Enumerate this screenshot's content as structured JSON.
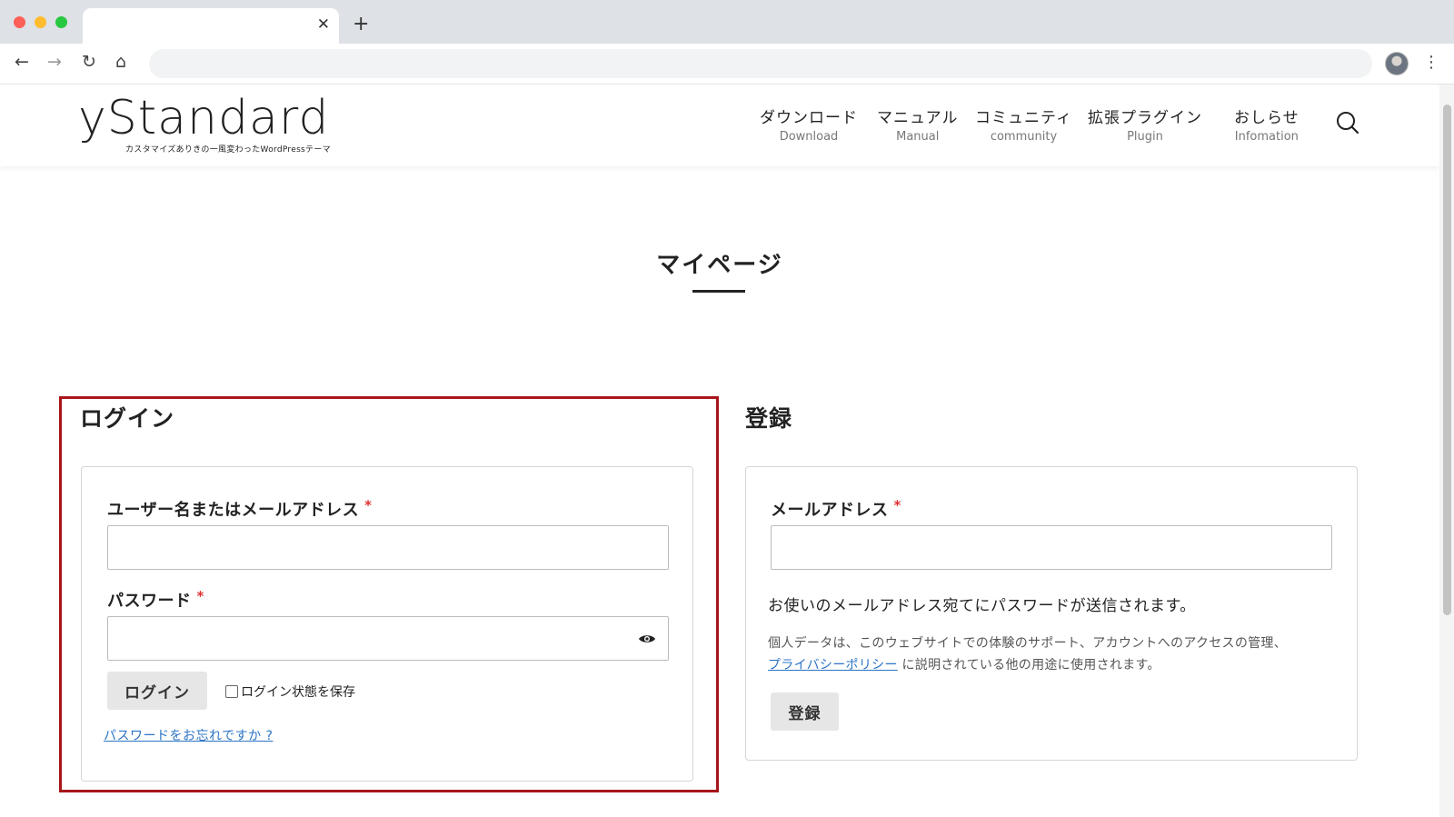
{
  "browser": {
    "tab_title": "",
    "tab_close": "✕",
    "new_tab": "+",
    "back": "←",
    "forward": "→",
    "reload": "↻",
    "home": "⌂",
    "menu": "⋮",
    "address": ""
  },
  "site": {
    "logo_text": "yStandard",
    "logo_tagline": "カスタマイズありきの一風変わったWordPressテーマ",
    "nav": [
      {
        "jp": "ダウンロード",
        "en": "Download"
      },
      {
        "jp": "マニュアル",
        "en": "Manual"
      },
      {
        "jp": "コミュニティ",
        "en": "community"
      },
      {
        "jp": "拡張プラグイン",
        "en": "Plugin"
      },
      {
        "jp": "おしらせ",
        "en": "Infomation"
      }
    ]
  },
  "page": {
    "title": "マイページ"
  },
  "login": {
    "heading": "ログイン",
    "username_label": "ユーザー名またはメールアドレス",
    "username_value": "",
    "password_label": "パスワード",
    "password_value": "",
    "required_mark": "*",
    "submit_label": "ログイン",
    "remember_label": "ログイン状態を保存",
    "remember_checked": false,
    "lost_password": "パスワードをお忘れですか ?"
  },
  "register": {
    "heading": "登録",
    "email_label": "メールアドレス",
    "email_value": "",
    "required_mark": "*",
    "notice": "お使いのメールアドレス宛てにパスワードが送信されます。",
    "privacy_text_1": "個人データは、このウェブサイトでの体験のサポート、アカウントへのアクセスの管理、",
    "privacy_link": "プライバシーポリシー",
    "privacy_text_2": " に説明されている他の用途に使用されます。",
    "submit_label": "登録"
  },
  "colors": {
    "highlight_border": "#a7161b",
    "link": "#2b74c4",
    "required": "#dd3333"
  }
}
